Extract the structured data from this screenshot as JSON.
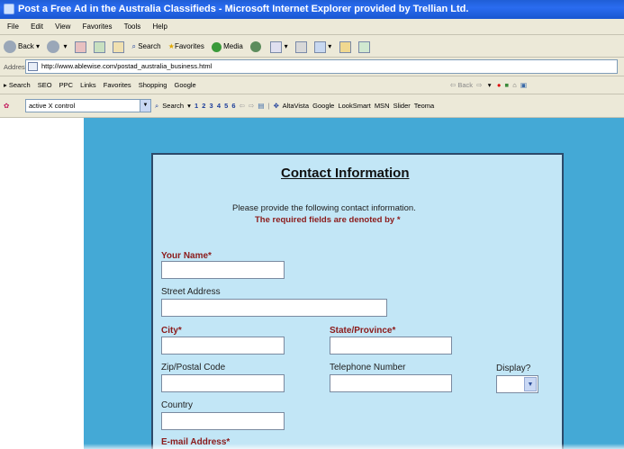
{
  "window": {
    "title": "Post a Free Ad in the Australia Classifieds - Microsoft Internet Explorer provided by Trellian Ltd."
  },
  "menu": [
    "File",
    "Edit",
    "View",
    "Favorites",
    "Tools",
    "Help"
  ],
  "toolbar": {
    "back": "Back",
    "search": "Search",
    "favorites": "Favorites",
    "media": "Media"
  },
  "address": {
    "label": "Address",
    "url": "http://www.ablewise.com/postad_australia_business.html"
  },
  "links_bar": {
    "items": [
      "Search",
      "SEO",
      "PPC",
      "Links",
      "Favorites",
      "Shopping",
      "Google"
    ],
    "back": "Back"
  },
  "search_bar": {
    "query": "active X control",
    "search": "Search",
    "numbers": [
      "1",
      "2",
      "3",
      "4",
      "5",
      "6"
    ],
    "engines": [
      "AltaVista",
      "Google",
      "LookSmart",
      "MSN",
      "Slider",
      "Teoma"
    ]
  },
  "form": {
    "title": "Contact Information",
    "intro": "Please provide the following contact information.",
    "required_note": "The required fields are denoted by *",
    "fields": {
      "name": {
        "label": "Your Name*",
        "value": ""
      },
      "street": {
        "label": "Street Address",
        "value": ""
      },
      "city": {
        "label": "City*",
        "value": ""
      },
      "state": {
        "label": "State/Province*",
        "value": ""
      },
      "zip": {
        "label": "Zip/Postal Code",
        "value": ""
      },
      "phone": {
        "label": "Telephone Number",
        "value": ""
      },
      "display": {
        "label": "Display?",
        "value": ""
      },
      "country": {
        "label": "Country",
        "value": ""
      },
      "email": {
        "label": "E-mail Address*"
      }
    }
  },
  "colors": {
    "title_bar": "#2a6cf0",
    "page_background": "#44a9d6",
    "panel_background": "#c2e6f6",
    "required_label": "#8b1a1a"
  }
}
